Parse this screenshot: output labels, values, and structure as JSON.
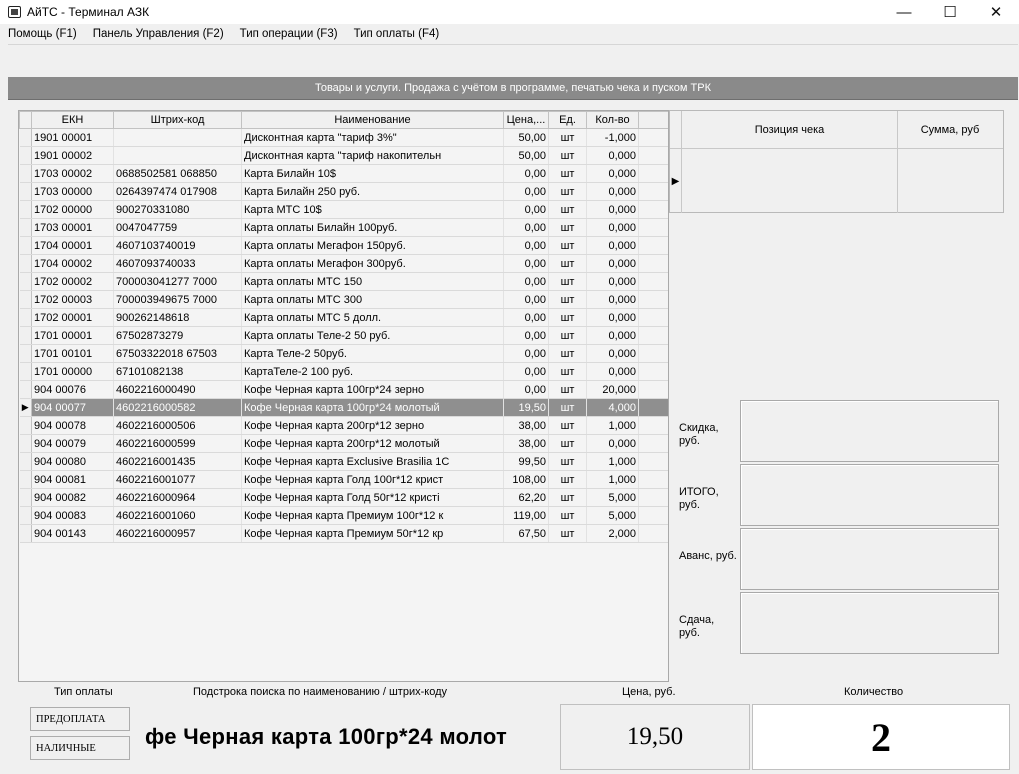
{
  "window": {
    "title": "АйТС - Терминал АЗК",
    "minimize": "—",
    "maximize": "☐",
    "close": "✕"
  },
  "menu": [
    "Помощь (F1)",
    "Панель Управления (F2)",
    "Тип операции (F3)",
    "Тип оплаты (F4)"
  ],
  "strip_title": "Товары и услуги. Продажа с учётом в программе, печатью чека и пуском ТРК",
  "table": {
    "columns": [
      "ЕКН",
      "Штрих-код",
      "Наименование",
      "Цена,...",
      "Ед.",
      "Кол-во"
    ],
    "selected_index": 15,
    "rows": [
      [
        "1901 00001",
        "",
        "Дисконтная карта \"тариф 3%\"",
        "50,00",
        "шт",
        "-1,000"
      ],
      [
        "1901 00002",
        "",
        "Дисконтная карта \"тариф накопительн",
        "50,00",
        "шт",
        "0,000"
      ],
      [
        "1703 00002",
        "0688502581 068850",
        "Карта Билайн 10$",
        "0,00",
        "шт",
        "0,000"
      ],
      [
        "1703 00000",
        "0264397474 017908",
        "Карта Билайн 250 руб.",
        "0,00",
        "шт",
        "0,000"
      ],
      [
        "1702 00000",
        "900270331080",
        "Карта МТС 10$",
        "0,00",
        "шт",
        "0,000"
      ],
      [
        "1703 00001",
        "0047047759",
        "Карта оплаты Билайн 100руб.",
        "0,00",
        "шт",
        "0,000"
      ],
      [
        "1704 00001",
        "4607103740019",
        "Карта оплаты Мегафон 150руб.",
        "0,00",
        "шт",
        "0,000"
      ],
      [
        "1704 00002",
        "4607093740033",
        "Карта оплаты Мегафон 300руб.",
        "0,00",
        "шт",
        "0,000"
      ],
      [
        "1702 00002",
        "700003041277 7000",
        "Карта оплаты МТС 150",
        "0,00",
        "шт",
        "0,000"
      ],
      [
        "1702 00003",
        "700003949675 7000",
        "Карта оплаты МТС 300",
        "0,00",
        "шт",
        "0,000"
      ],
      [
        "1702 00001",
        "900262148618",
        "Карта оплаты МТС 5 долл.",
        "0,00",
        "шт",
        "0,000"
      ],
      [
        "1701 00001",
        "67502873279",
        "Карта оплаты Теле-2  50 руб.",
        "0,00",
        "шт",
        "0,000"
      ],
      [
        "1701 00101",
        "67503322018 67503",
        "Карта Теле-2  50руб.",
        "0,00",
        "шт",
        "0,000"
      ],
      [
        "1701 00000",
        "67101082138",
        "КартаТеле-2 100 руб.",
        "0,00",
        "шт",
        "0,000"
      ],
      [
        "  904 00076",
        "4602216000490",
        "Кофе Черная карта  100гр*24 зерно",
        "0,00",
        "шт",
        "20,000"
      ],
      [
        "  904 00077",
        "4602216000582",
        "Кофе Черная карта  100гр*24 молотый",
        "19,50",
        "шт",
        "4,000"
      ],
      [
        "  904 00078",
        "4602216000506",
        "Кофе Черная карта  200гр*12 зерно",
        "38,00",
        "шт",
        "1,000"
      ],
      [
        "  904 00079",
        "4602216000599",
        "Кофе Черная карта  200гр*12 молотый",
        "38,00",
        "шт",
        "0,000"
      ],
      [
        "  904 00080",
        "4602216001435",
        "Кофе Черная карта Exclusive Brasilia 1С",
        "99,50",
        "шт",
        "1,000"
      ],
      [
        "  904 00081",
        "4602216001077",
        "Кофе Черная карта Голд 100г*12 крист",
        "108,00",
        "шт",
        "1,000"
      ],
      [
        "  904 00082",
        "4602216000964",
        "Кофе Черная карта Голд 50г*12 кристі",
        "62,20",
        "шт",
        "5,000"
      ],
      [
        "  904 00083",
        "4602216001060",
        "Кофе Черная карта Премиум 100г*12 к",
        "119,00",
        "шт",
        "5,000"
      ],
      [
        "  904 00143",
        "4602216000957",
        "Кофе Черная карта Премиум 50г*12 кр",
        "67,50",
        "шт",
        "2,000"
      ]
    ]
  },
  "receipt": {
    "col_position": "Позиция чека",
    "col_sum": "Сумма, руб",
    "row_marker": "▶"
  },
  "totals": {
    "discount": "Скидка, руб.",
    "total": "ИТОГО, руб.",
    "advance": "Аванс, руб.",
    "change": "Сдача, руб."
  },
  "bottom": {
    "label_payment": "Тип оплаты",
    "label_search": "Подстрока поиска по наименованию / штрих-коду",
    "label_price": "Цена, руб.",
    "label_qty": "Количество",
    "btn_prepay": "ПРЕДОПЛАТА",
    "btn_cash": "НАЛИЧНЫЕ",
    "search_text": "фе Черная карта  100гр*24 молот",
    "price": "19,50",
    "quantity": "2"
  }
}
